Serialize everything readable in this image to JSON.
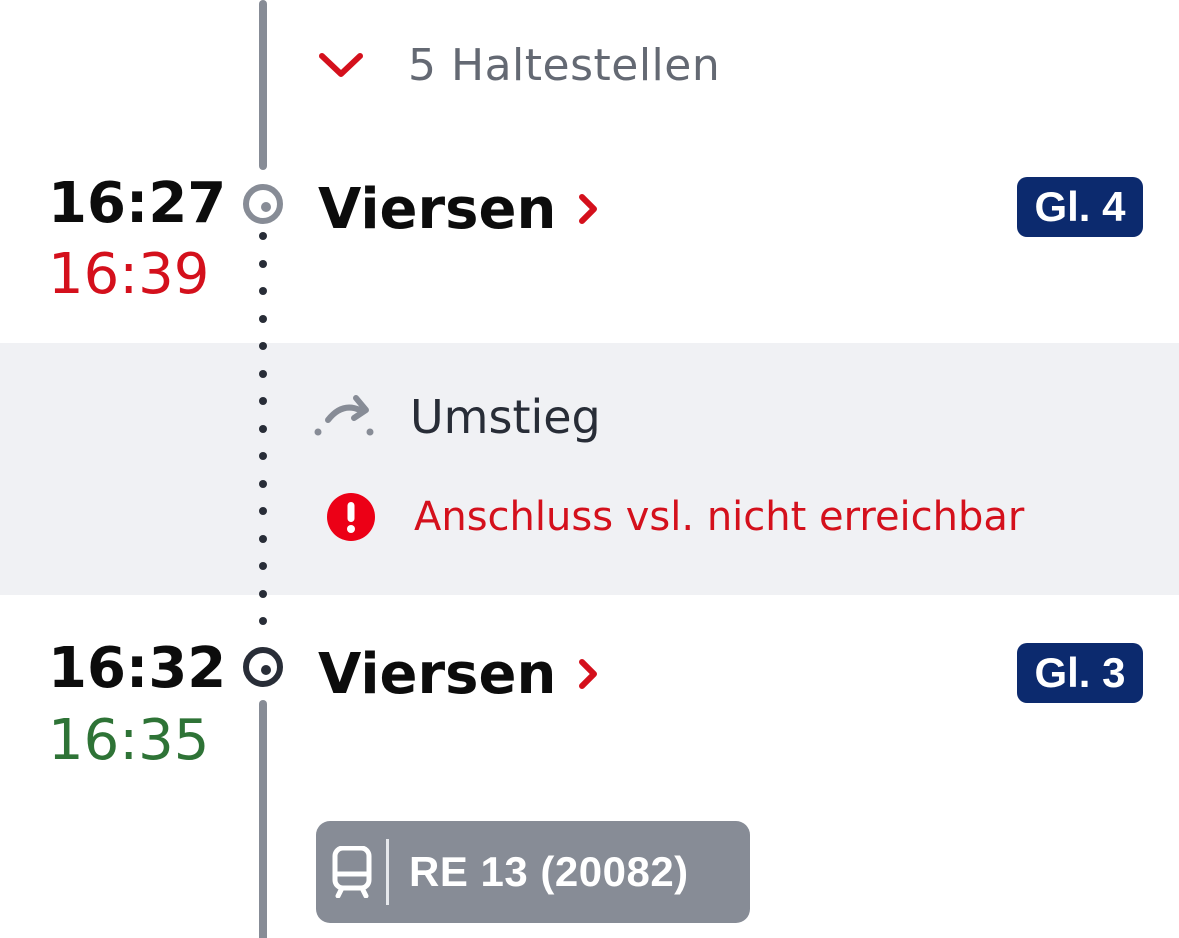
{
  "stops_toggle": {
    "label": "5 Haltestellen",
    "icon": "chevron-down-icon"
  },
  "arrival": {
    "planned_time": "16:27",
    "actual_time": "16:39",
    "station": "Viersen",
    "platform": "Gl. 4"
  },
  "transfer": {
    "label": "Umstieg",
    "icon": "transfer-arrow-icon",
    "warning": "Anschluss vsl. nicht erreichbar",
    "warning_icon": "alert-icon"
  },
  "departure": {
    "planned_time": "16:32",
    "actual_time": "16:35",
    "station": "Viersen",
    "platform": "Gl. 3"
  },
  "train": {
    "label": "RE 13 (20082)",
    "icon": "train-icon"
  },
  "colors": {
    "delay_red": "#d4101c",
    "ontime_green": "#2e7336",
    "platform_navy": "#0c2a6e",
    "timeline_grey": "#878c96",
    "band_grey": "#f0f1f4"
  }
}
